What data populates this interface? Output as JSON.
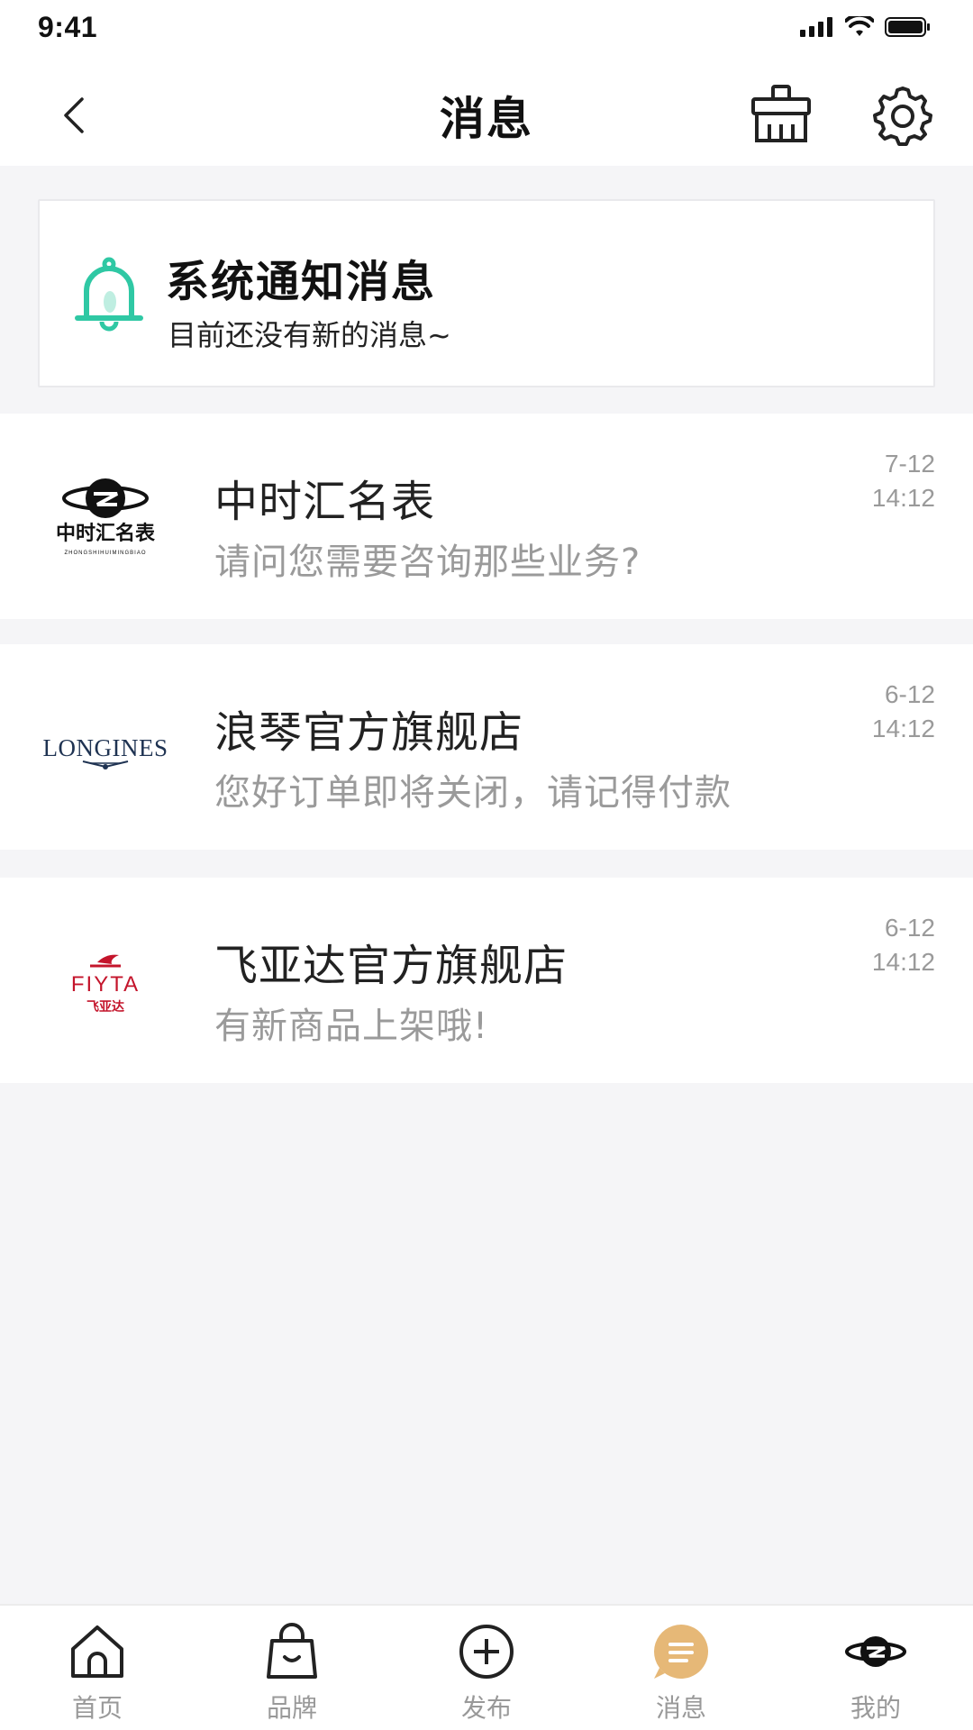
{
  "status_bar": {
    "time": "9:41"
  },
  "nav": {
    "title": "消息",
    "back_icon": "chevron-left-icon",
    "clean_icon": "broom-icon",
    "settings_icon": "gear-icon"
  },
  "notice": {
    "title": "系统通知消息",
    "subtitle": "目前还没有新的消息~",
    "icon": "bell-icon",
    "accent_color": "#2fc8a4"
  },
  "messages": [
    {
      "name": "中时汇名表",
      "preview": "请问您需要咨询那些业务?",
      "date": "7-12",
      "time": "14:12",
      "logo_text": "中时汇名表",
      "logo_sub": "ZHONGSHIHUIMINGBIAO"
    },
    {
      "name": "浪琴官方旗舰店",
      "preview": "您好订单即将关闭，请记得付款",
      "date": "6-12",
      "time": "14:12",
      "logo_text": "LONGINES"
    },
    {
      "name": "飞亚达官方旗舰店",
      "preview": "有新商品上架哦!",
      "date": "6-12",
      "time": "14:12",
      "logo_text": "FIYTA",
      "logo_sub": "飞亚达"
    }
  ],
  "tabs": [
    {
      "label": "首页",
      "icon": "home-icon"
    },
    {
      "label": "品牌",
      "icon": "shopping-bag-icon"
    },
    {
      "label": "发布",
      "icon": "plus-circle-icon"
    },
    {
      "label": "消息",
      "icon": "message-icon",
      "active": true
    },
    {
      "label": "我的",
      "icon": "profile-logo-icon"
    }
  ],
  "colors": {
    "active_tab": "#e6b877",
    "accent": "#2fc8a4",
    "fiyta_red": "#c4142b",
    "longines_navy": "#1f3352"
  }
}
